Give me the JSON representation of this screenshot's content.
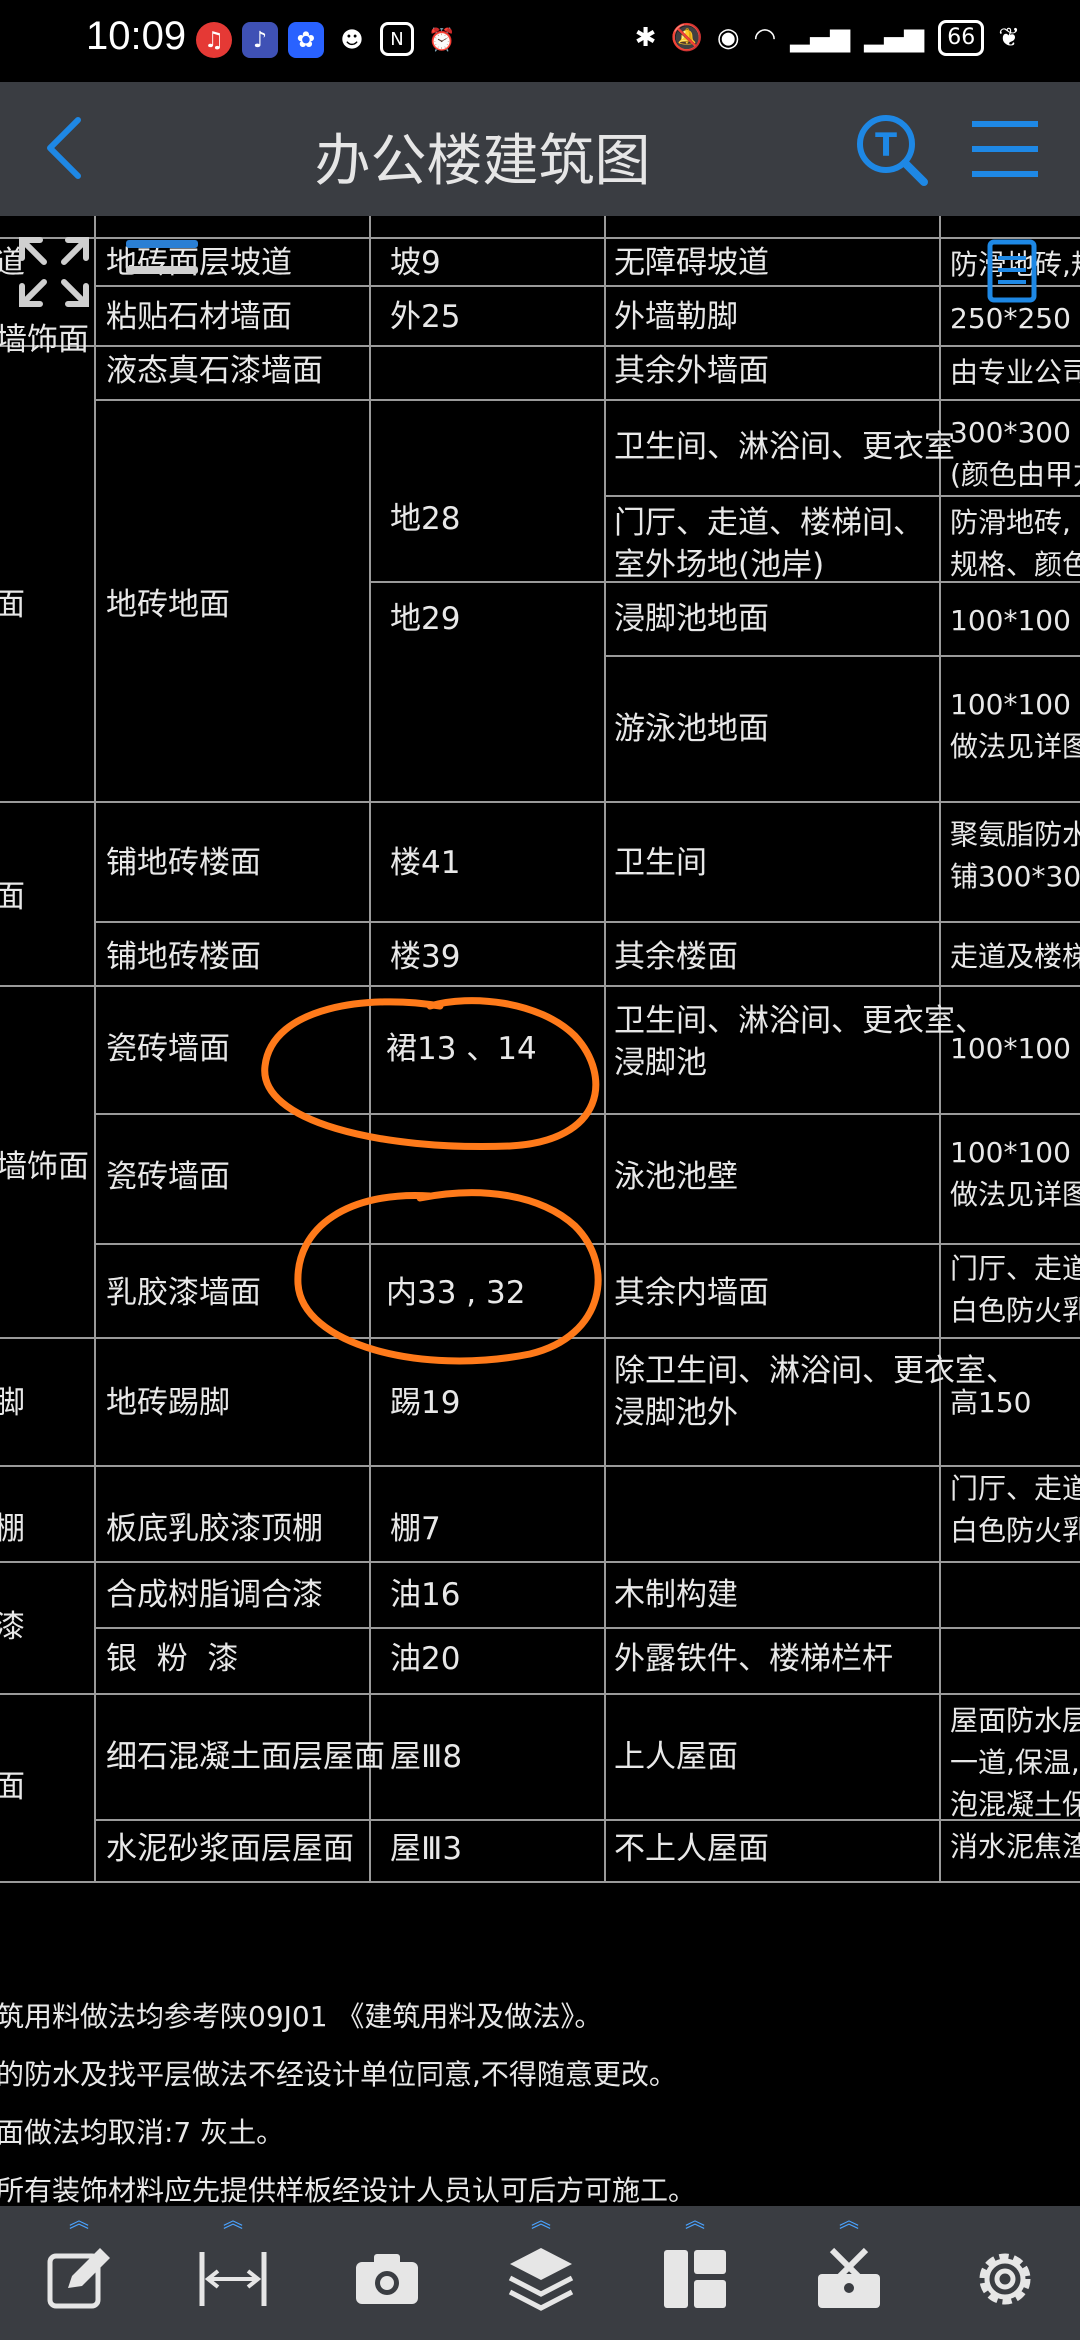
{
  "status_bar": {
    "time": "10:09",
    "left_icons": [
      "netease-music-icon",
      "music-icon",
      "baidu-icon",
      "qq-icon",
      "nfc-icon",
      "alarm-icon"
    ],
    "right_icons": [
      "bluetooth-icon",
      "mute-icon",
      "hotspot-icon",
      "wifi-icon",
      "signal-4g-icon",
      "signal-4g-icon"
    ],
    "battery": "66"
  },
  "header": {
    "title": "办公楼建筑图",
    "accent_color": "#1e88e5"
  },
  "table": {
    "rows": [
      {
        "c1": "道",
        "c2": "地砖面层坡道",
        "c3": "坡9",
        "c4": "无障碍坡道",
        "c5": "防滑地砖,规"
      },
      {
        "c1": "墙饰面",
        "c2": "粘贴石材墙面",
        "c3": "外25",
        "c4": "外墙勒脚",
        "c5": "250*250"
      },
      {
        "c1": "",
        "c2": "液态真石漆墙面",
        "c3": "",
        "c4": "其余外墙面",
        "c5": "由专业公司"
      },
      {
        "c1": "",
        "c2": "",
        "c3": "地28",
        "c4": "卫生间、淋浴间、更衣室",
        "c5": "300*300\n(颜色由甲方"
      },
      {
        "c1": "面",
        "c2": "地砖地面",
        "c3": "",
        "c4": "门厅、走道、楼梯间、\n室外场地(池岸)",
        "c5": "防滑地砖,\n规格、颜色"
      },
      {
        "c1": "",
        "c2": "",
        "c3": "地29",
        "c4": "浸脚池地面",
        "c5": "100*100"
      },
      {
        "c1": "",
        "c2": "",
        "c3": "",
        "c4": "游泳池地面",
        "c5": "100*100\n做法见详图"
      },
      {
        "c1": "面",
        "c2": "铺地砖楼面",
        "c3": "楼41",
        "c4": "卫生间",
        "c5": "聚氨脂防水\n铺300*300"
      },
      {
        "c1": "",
        "c2": "铺地砖楼面",
        "c3": "楼39",
        "c4": "其余楼面",
        "c5": "走道及楼梯"
      },
      {
        "c1": "",
        "c2": "瓷砖墙面",
        "c3": "裙13 、14",
        "c4": "卫生间、淋浴间、更衣室、\n浸脚池",
        "c5": "100*100"
      },
      {
        "c1": "墙饰面",
        "c2": "瓷砖墙面",
        "c3": "",
        "c4": "泳池池壁",
        "c5": "100*100\n做法见详图"
      },
      {
        "c1": "",
        "c2": "乳胶漆墙面",
        "c3": "内33 , 32",
        "c4": "其余内墙面",
        "c5": "门厅、走道\n白色防火乳"
      },
      {
        "c1": "脚",
        "c2": "地砖踢脚",
        "c3": "踢19",
        "c4": "除卫生间、淋浴间、更衣室、\n浸脚池外",
        "c5": "高150"
      },
      {
        "c1": "棚",
        "c2": "板底乳胶漆顶棚",
        "c3": "棚7",
        "c4": "",
        "c5": "门厅、走道\n白色防火乳"
      },
      {
        "c1": "漆",
        "c2": "合成树脂调合漆",
        "c3": "油16",
        "c4": "木制构建",
        "c5": ""
      },
      {
        "c1": "",
        "c2": "银  粉  漆",
        "c3": "油20",
        "c4": "外露铁件、楼梯栏杆",
        "c5": ""
      },
      {
        "c1": "面",
        "c2": "细石混凝土面层屋面",
        "c3": "屋Ⅲ8",
        "c4": "上人屋面",
        "c5": "屋面防水层\n一道,保温,\n泡混凝土保\n消水泥焦渣"
      },
      {
        "c1": "",
        "c2": "水泥砂浆面层屋面",
        "c3": "屋Ⅲ3",
        "c4": "不上人屋面",
        "c5": ""
      }
    ]
  },
  "notes": [
    "筑用料做法均参考陕09J01 《建筑用料及做法》。",
    "的防水及找平层做法不经设计单位同意,不得随意更改。",
    "面做法均取消:7 灰土。",
    "所有装饰材料应先提供样板经设计人员认可后方可施工。"
  ],
  "annotations": {
    "color": "#ff7a1a",
    "count": 2
  },
  "toolbar": {
    "items": [
      "edit-icon",
      "measure-icon",
      "camera-icon",
      "layers-icon",
      "layout-icon",
      "toolbox-icon",
      "settings-icon"
    ]
  }
}
